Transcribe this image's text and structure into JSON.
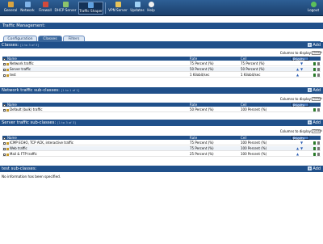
{
  "nav": {
    "items": [
      {
        "label": "General",
        "color": "#d9a441"
      },
      {
        "label": "Network",
        "color": "#7fb3e8"
      },
      {
        "label": "Firewall",
        "color": "#d24a3c"
      },
      {
        "label": "DHCP Server",
        "color": "#8cc36b"
      },
      {
        "label": "Traffic Shaper",
        "color": "#5fa0e0"
      },
      {
        "label": "VPN Server",
        "color": "#e6c35a"
      },
      {
        "label": "Updates",
        "color": "#9fd0f5"
      },
      {
        "label": "Help",
        "color": "#f0f0f0"
      }
    ],
    "active_index": 4,
    "logout": "Logout"
  },
  "page_title": "Traffic Management:",
  "tabs": [
    "Configuration",
    "Classes",
    "Filters"
  ],
  "active_tab": 1,
  "columns_to_display": "Columns to display:",
  "select_placeholder": "Select",
  "add_label": "Add",
  "table_headers": {
    "name": "Name",
    "rate": "Rate",
    "ceil": "Ceil",
    "priority": "Priority"
  },
  "sections": {
    "classes": {
      "title": "Classes:",
      "count": "[1 to 3 of 3]",
      "rows": [
        {
          "name": "Network traffic",
          "rate": "75 Percent (%)",
          "ceil": "75 Percent (%)",
          "prio": "down"
        },
        {
          "name": "Server traffic",
          "rate": "50 Percent (%)",
          "ceil": "50 Percent (%)",
          "prio": "updown"
        },
        {
          "name": "test",
          "rate": "1 Kilobit/sec",
          "ceil": "1 Kilobit/sec",
          "prio": "up"
        }
      ]
    },
    "network": {
      "title": "Network traffic sub-classes:",
      "count": "[1 to 1 of 1]",
      "rows": [
        {
          "name": "Default (bulk) traffic",
          "rate": "50 Percent (%)",
          "ceil": "100 Percent (%)",
          "prio": ""
        }
      ]
    },
    "server": {
      "title": "Server traffic sub-classes:",
      "count": "[1 to 3 of 3]",
      "rows": [
        {
          "name": "ICMP ECHO, TCP ACK, interactive traffic",
          "rate": "75 Percent (%)",
          "ceil": "100 Percent (%)",
          "prio": "down"
        },
        {
          "name": "Web traffic",
          "rate": "75 Percent (%)",
          "ceil": "100 Percent (%)",
          "prio": "updown"
        },
        {
          "name": "Mail & FTP traffic",
          "rate": "25 Percent (%)",
          "ceil": "100 Percent (%)",
          "prio": "up"
        }
      ]
    },
    "test": {
      "title": "test sub-classes:",
      "no_info": "No information has been specified."
    }
  }
}
